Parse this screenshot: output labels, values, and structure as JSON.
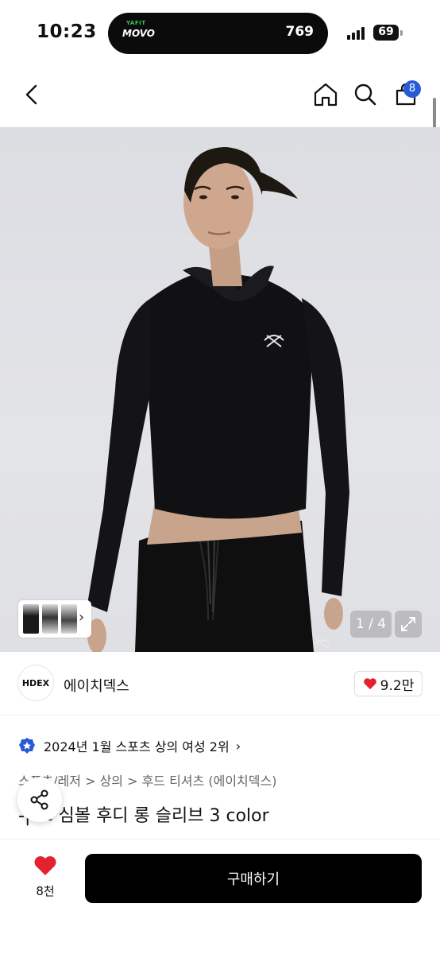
{
  "status_bar": {
    "time": "10:23",
    "island_app_top": "YAFIT",
    "island_app_name": "MOVO",
    "island_steps": "769",
    "battery": "69"
  },
  "nav": {
    "cart_badge": "8",
    "icons": [
      "back-icon",
      "home-icon",
      "search-icon",
      "cart-icon"
    ]
  },
  "gallery": {
    "counter": "1 / 4",
    "chevron": "›"
  },
  "brand": {
    "logo_text": "HDEX",
    "name": "에이치덱스",
    "likes": "9.2만"
  },
  "ranking": {
    "text": "2024년 1월 스포츠 상의 여성 2위",
    "chevron": "›"
  },
  "breadcrumbs": {
    "text": "스포츠/레저 > 상의 > 후드 티셔츠 (에이치덱스)"
  },
  "product": {
    "title": "스 심볼 후디 롱 슬리브 3 color",
    "title_prefix": "-|"
  },
  "bottom_bar": {
    "wish_count": "8천",
    "buy_label": "구매하기"
  },
  "colors": {
    "accent_blue": "#2a5bd7",
    "heart_red": "#e4212f",
    "buy_button": "#000000"
  }
}
